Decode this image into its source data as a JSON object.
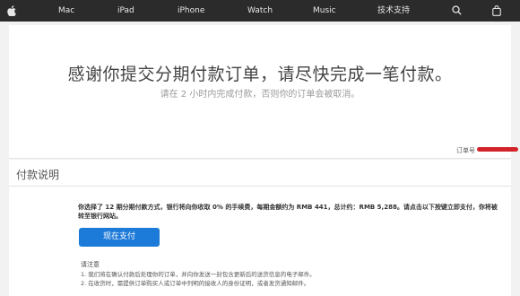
{
  "nav": {
    "items": [
      "Mac",
      "iPad",
      "iPhone",
      "Watch",
      "Music",
      "技术支持"
    ]
  },
  "confirmation": {
    "headline": "感谢你提交分期付款订单，请尽快完成一笔付款。",
    "subline": "请在 2 小时内完成付款，否则你的订单会被取消。",
    "order_label": "订单号"
  },
  "payment": {
    "section_title": "付款说明",
    "summary": "你选择了 12 期分期付款方式，银行将向你收取 0% 的手续费，每期金额约为 RMB 441，总计约：RMB 5,288。请点击以下按键立即支付，你将被转至银行网站。",
    "pay_button": "现在支付",
    "note_title": "请注意",
    "notes": [
      "1. 我们将在确认付款后处理你的订单，并向你发送一封包含更新后的送货信息的电子邮件。",
      "2. 在收货时，需提供订单购买人或订单中列明的接收人的身份证明，或者发货通知邮件。"
    ]
  }
}
